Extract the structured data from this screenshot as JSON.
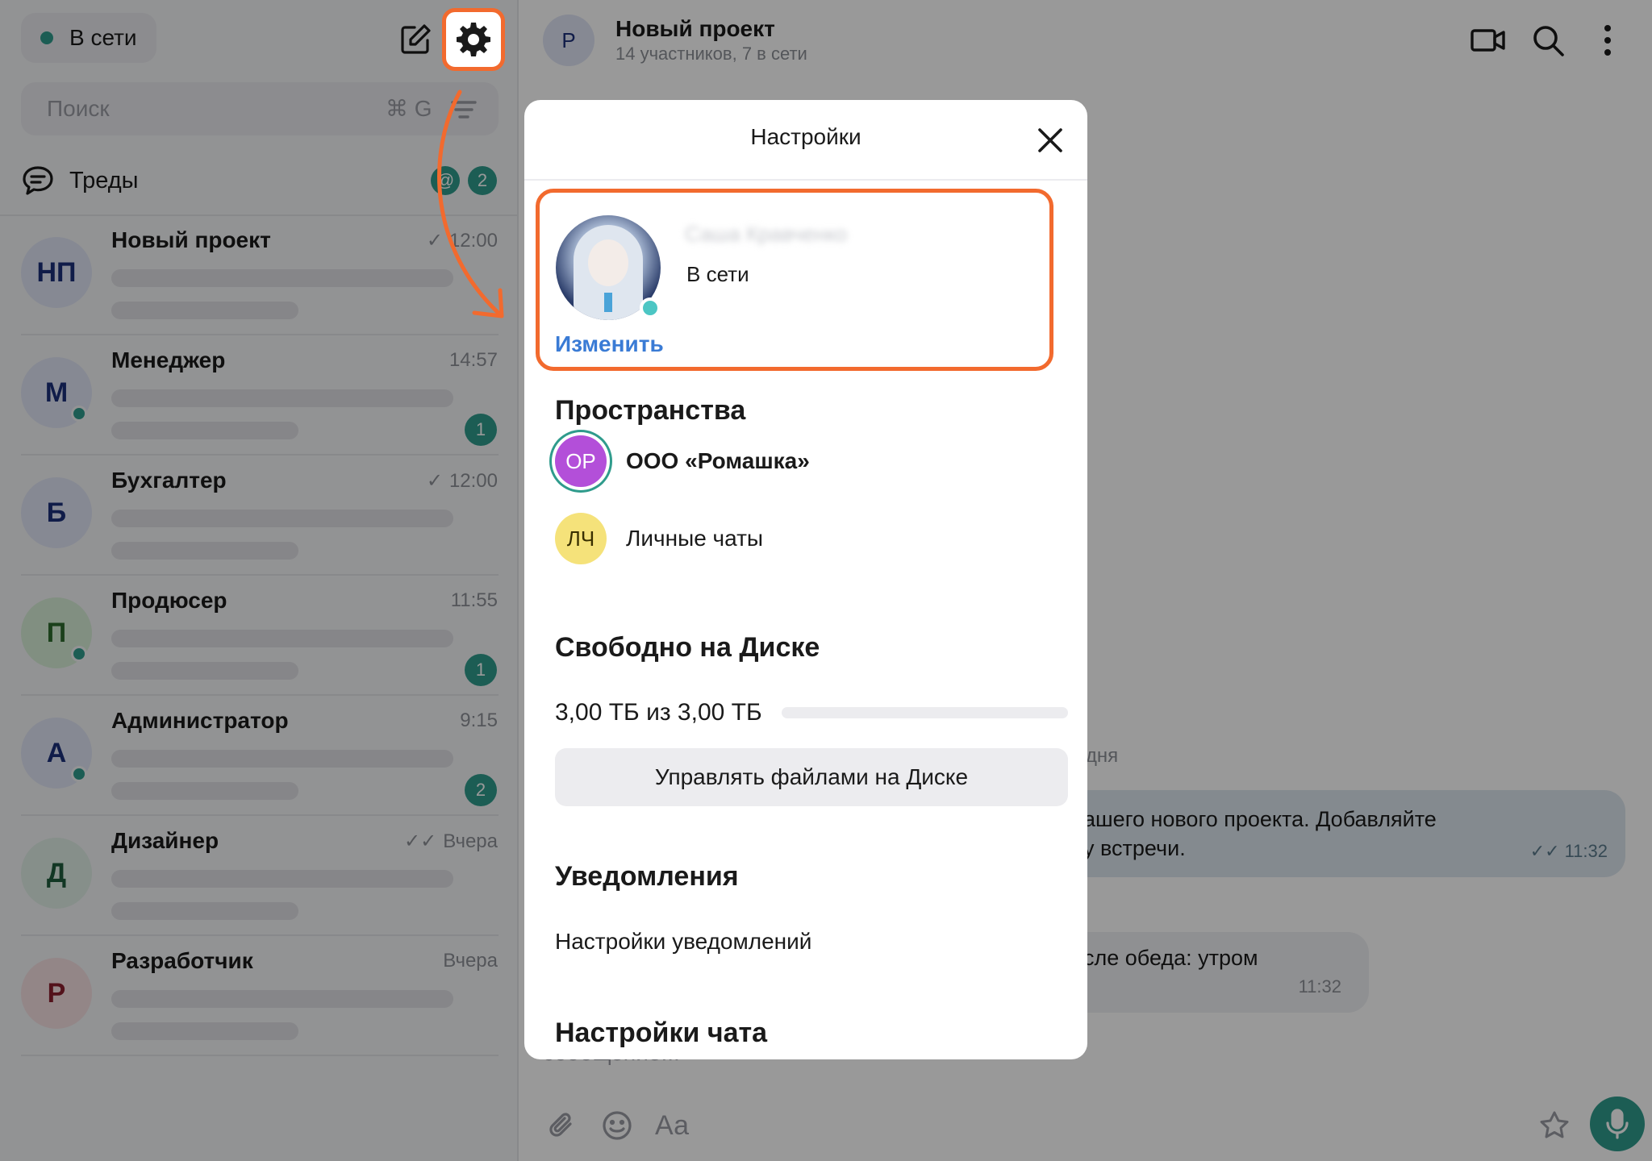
{
  "sidebar": {
    "status": "В сети",
    "search_placeholder": "Поиск",
    "search_shortcut": "⌘ G",
    "threads_label": "Треды",
    "threads_mention": "@",
    "threads_count": "2",
    "chats": [
      {
        "initials": "НП",
        "name": "Новый проект",
        "time": "12:00",
        "checks": "✓",
        "online": false,
        "unread": "",
        "bg": "#dfe4f5",
        "fg": "#1c2f7a"
      },
      {
        "initials": "М",
        "name": "Менеджер",
        "time": "14:57",
        "checks": "",
        "online": true,
        "unread": "1",
        "bg": "#dfe4f5",
        "fg": "#1c2f7a"
      },
      {
        "initials": "Б",
        "name": "Бухгалтер",
        "time": "12:00",
        "checks": "✓",
        "online": false,
        "unread": "",
        "bg": "#dfe4f5",
        "fg": "#1c2f7a"
      },
      {
        "initials": "П",
        "name": "Продюсер",
        "time": "11:55",
        "checks": "",
        "online": true,
        "unread": "1",
        "bg": "#d8eed8",
        "fg": "#2e6b2e"
      },
      {
        "initials": "А",
        "name": "Администратор",
        "time": "9:15",
        "checks": "",
        "online": true,
        "unread": "2",
        "bg": "#dfe4f5",
        "fg": "#1c2f7a"
      },
      {
        "initials": "Д",
        "name": "Дизайнер",
        "time": "Вчера",
        "checks": "✓✓",
        "online": false,
        "unread": "",
        "bg": "#dfeee6",
        "fg": "#1f5c3c"
      },
      {
        "initials": "Р",
        "name": "Разработчик",
        "time": "Вчера",
        "checks": "",
        "online": false,
        "unread": "",
        "bg": "#f5dfe2",
        "fg": "#8a1f2e"
      }
    ]
  },
  "main": {
    "chat_avatar": "Р",
    "chat_title": "Новый проект",
    "chat_subtitle": "14 участников, 7 в сети",
    "day_label": "одня",
    "message_out_line1": "ашего нового проекта. Добавляйте",
    "message_out_line2": "у встречи.",
    "message_out_time": "11:32",
    "message_out_checks": "✓✓",
    "message_in_text": "сле обеда: утром",
    "message_in_time": "11:32",
    "composer_placeholder": "сообщение...",
    "text_format_label": "Аа"
  },
  "settings": {
    "title": "Настройки",
    "profile": {
      "name": "Саша Кравченко",
      "status": "В сети",
      "edit_label": "Изменить"
    },
    "spaces_title": "Пространства",
    "spaces": [
      {
        "initials": "ОР",
        "label": "ООО «Ромашка»",
        "bg": "#b34fd9",
        "fg": "#ffffff",
        "active": true
      },
      {
        "initials": "ЛЧ",
        "label": "Личные чаты",
        "bg": "#f5e27a",
        "fg": "#3a3000",
        "active": false
      }
    ],
    "disk_title": "Свободно на Диске",
    "disk_text": "3,00 ТБ из 3,00 ТБ",
    "disk_used_fraction": 0,
    "disk_button": "Управлять файлами на Диске",
    "notifications_title": "Уведомления",
    "notifications_link": "Настройки уведомлений",
    "chat_settings_title": "Настройки чата"
  },
  "colors": {
    "accent": "#2f9b8c",
    "highlight": "#f26a2e",
    "link": "#3a7bd5"
  },
  "icons": {
    "compose": "compose-icon",
    "settings": "gear-icon",
    "filter": "filter-icon",
    "threads": "chat-bubble-icon",
    "video": "video-camera-icon",
    "search": "search-icon",
    "more": "more-vertical-icon",
    "close": "close-icon",
    "attach": "paperclip-icon",
    "emoji": "smile-icon",
    "star": "star-icon",
    "mic": "microphone-icon"
  }
}
